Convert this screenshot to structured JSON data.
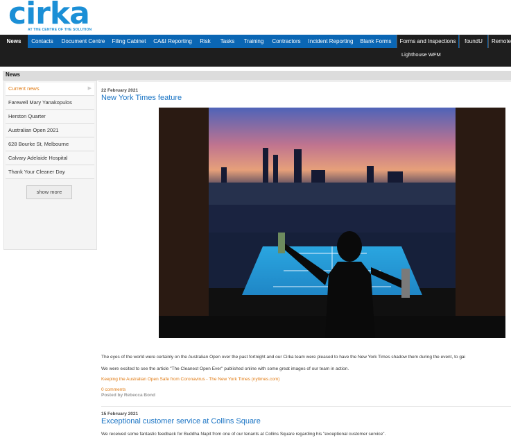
{
  "brand": {
    "logo_text": "cirka",
    "tagline": "AT THE CENTRE OF THE SOLUTION",
    "color": "#1b8fd6"
  },
  "nav": {
    "items": [
      {
        "label": "News"
      },
      {
        "label": "Contacts"
      },
      {
        "label": "Document Centre"
      },
      {
        "label": "Filing Cabinet"
      },
      {
        "label": "CA&I Reporting"
      },
      {
        "label": "Risk"
      },
      {
        "label": "Tasks"
      },
      {
        "label": "Training"
      },
      {
        "label": "Contractors"
      },
      {
        "label": "Incident Reporting"
      },
      {
        "label": "Blank Forms"
      },
      {
        "label": "Forms and Inspections"
      },
      {
        "label": "foundU"
      },
      {
        "label": "Remote"
      }
    ],
    "sub_items": [
      {
        "label": "Lighthouse WFM"
      }
    ],
    "colors": {
      "bar": "#0a66b4",
      "dark": "#1e1e1e"
    }
  },
  "section": {
    "title": "News"
  },
  "sidebar": {
    "items": [
      {
        "label": "Current news"
      },
      {
        "label": "Farewell Mary Yanakopulos"
      },
      {
        "label": "Herston Quarter"
      },
      {
        "label": "Australian Open 2021"
      },
      {
        "label": "628 Bourke St, Melbourne"
      },
      {
        "label": "Calvary Adelaide Hospital"
      },
      {
        "label": "Thank Your Cleaner Day"
      }
    ],
    "show_more": "show more"
  },
  "articles": [
    {
      "date": "22 February 2021",
      "title": "New York Times feature",
      "paragraphs": [
        "The eyes of the world were certainly on the Australian Open over the past fortnight and our Cirka team were pleased to have the New York Times shadow them during the event, to gai",
        "We were excited to see the article \"The Cleanest Open Ever\" published online with some great images of our team in action."
      ],
      "link": "Keeping the Australian Open Safe from Coronavirus - The New York Times (nytimes.com)",
      "comments": "0 comments",
      "posted_by": "Posted by Rebecca Bond"
    },
    {
      "date": "15 February 2021",
      "title": "Exceptional customer service at Collins Square",
      "paragraphs": [
        "We received some fantastic feedback for Buddha Napit from one of our tenants at Collins Square regarding his \"exceptional customer service\"."
      ]
    }
  ],
  "accent_colors": {
    "link": "#1a74c4",
    "orange": "#e07a12"
  }
}
